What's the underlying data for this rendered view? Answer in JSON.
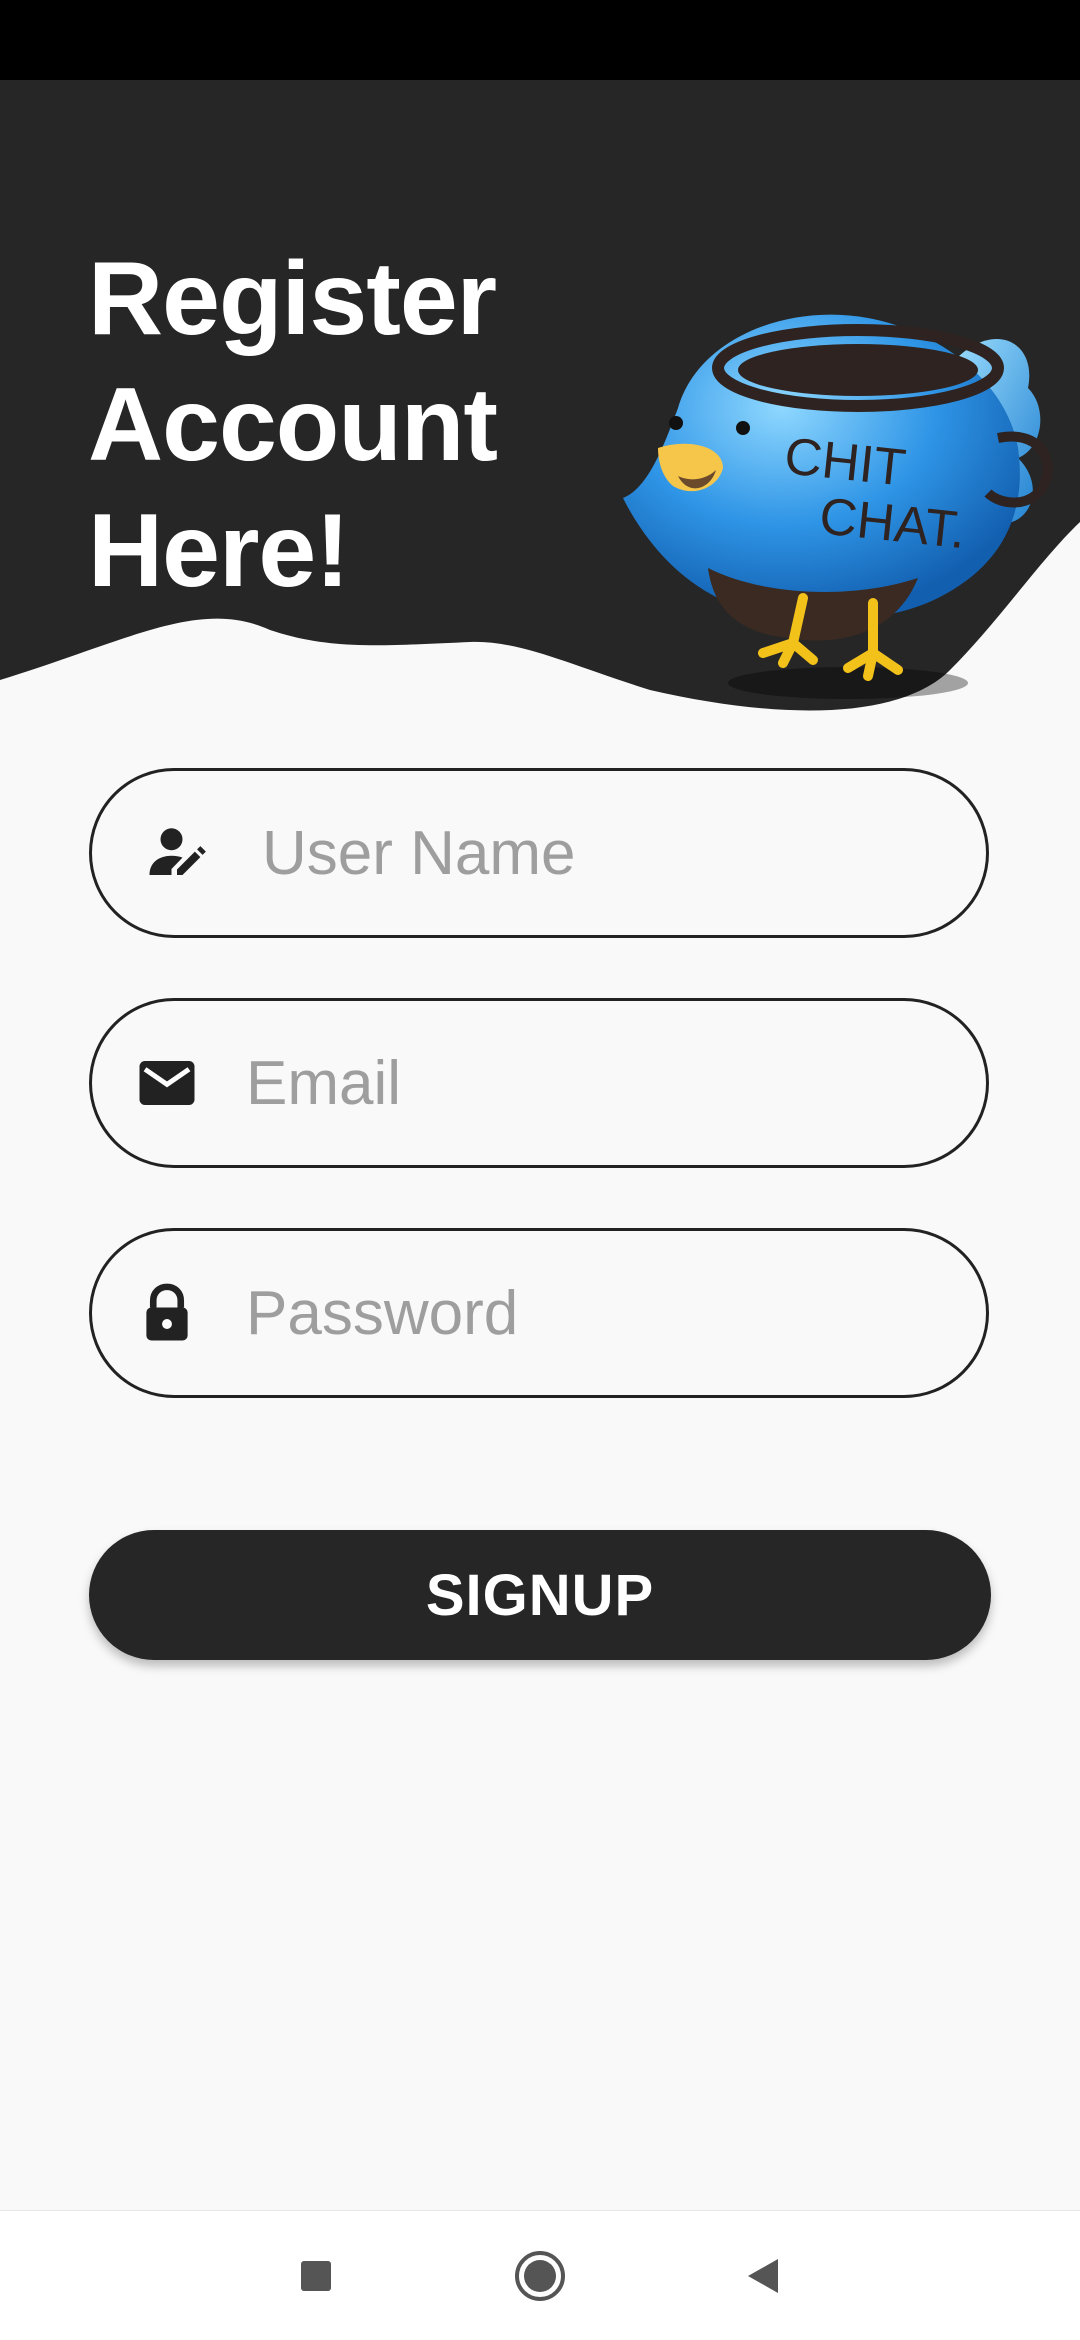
{
  "header": {
    "title_line1": "Register",
    "title_line2": "Account",
    "title_line3": "Here!",
    "logo_text_line1": "CHIT",
    "logo_text_line2": "CHAT."
  },
  "form": {
    "username": {
      "placeholder": "User Name",
      "value": "",
      "icon": "user-edit-icon"
    },
    "email": {
      "placeholder": "Email",
      "value": "",
      "icon": "mail-icon"
    },
    "password": {
      "placeholder": "Password",
      "value": "",
      "icon": "lock-icon"
    },
    "signup_label": "SIGNUP"
  },
  "nav": {
    "recents": "square-icon",
    "home": "circle-icon",
    "back": "triangle-back-icon"
  },
  "colors": {
    "header_bg": "#262626",
    "page_bg": "#f9f9f9",
    "button_bg": "#262626",
    "placeholder": "#9e9e9e",
    "logo_blue": "#2b8fe0"
  }
}
